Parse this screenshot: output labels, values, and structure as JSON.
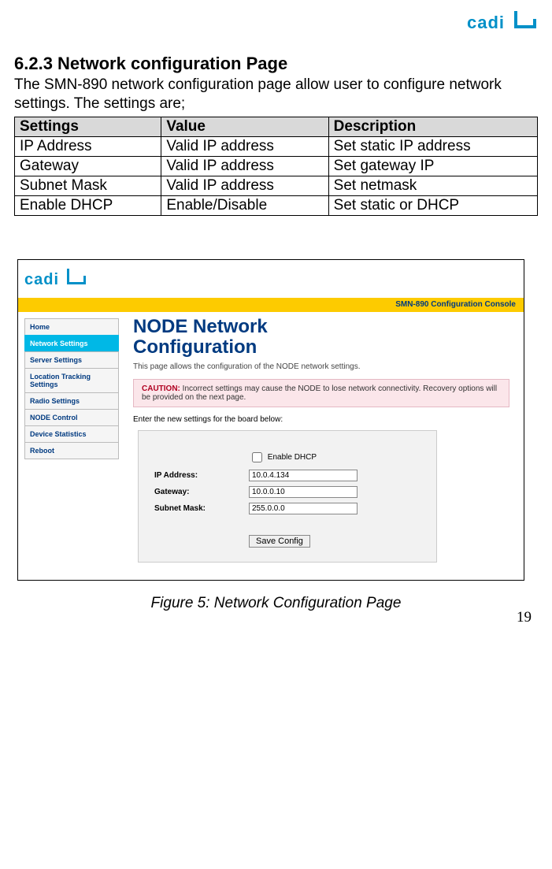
{
  "logo_text": "cadi",
  "section_heading": "6.2.3 Network configuration Page",
  "intro_text": "The SMN-890 network configuration page allow user to configure network settings. The settings are;",
  "table": {
    "headers": [
      "Settings",
      "Value",
      "Description"
    ],
    "rows": [
      [
        "IP Address",
        "Valid IP address",
        "Set static IP address"
      ],
      [
        "Gateway",
        "Valid IP address",
        "Set gateway IP"
      ],
      [
        "Subnet Mask",
        "Valid IP address",
        "Set netmask"
      ],
      [
        "Enable DHCP",
        "Enable/Disable",
        "Set static or DHCP"
      ]
    ]
  },
  "console": {
    "bar_title": "SMN-890 Configuration Console",
    "nav": [
      {
        "label": "Home",
        "active": false
      },
      {
        "label": "Network Settings",
        "active": true
      },
      {
        "label": "Server Settings",
        "active": false
      },
      {
        "label": "Location Tracking Settings",
        "active": false
      },
      {
        "label": "Radio Settings",
        "active": false
      },
      {
        "label": "NODE Control",
        "active": false
      },
      {
        "label": "Device Statistics",
        "active": false
      },
      {
        "label": "Reboot",
        "active": false
      }
    ],
    "page_title_line1": "NODE Network",
    "page_title_line2": "Configuration",
    "desc": "This page allows the configuration of the NODE network settings.",
    "caution_label": "CAUTION:",
    "caution_text": " Incorrect settings may cause the NODE to lose network connectivity. Recovery options will be provided on the next page.",
    "enter_text": "Enter the new settings for the board below:",
    "form": {
      "dhcp_label": "Enable DHCP",
      "dhcp_checked": false,
      "fields": [
        {
          "label": "IP Address:",
          "value": "10.0.4.134"
        },
        {
          "label": "Gateway:",
          "value": "10.0.0.10"
        },
        {
          "label": "Subnet Mask:",
          "value": "255.0.0.0"
        }
      ],
      "save_label": "Save Config"
    }
  },
  "figure_caption": "Figure 5: Network Configuration Page",
  "page_number": "19"
}
